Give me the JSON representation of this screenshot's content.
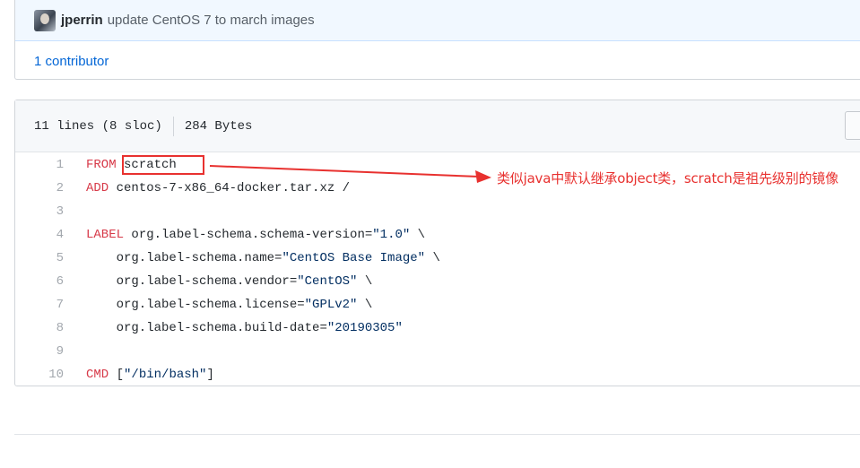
{
  "commit": {
    "author": "jperrin",
    "message": "update CentOS 7 to march images",
    "contributors": "1 contributor"
  },
  "file": {
    "lines_info": "11 lines (8 sloc)",
    "size": "284 Bytes"
  },
  "code": [
    {
      "num": "1",
      "kw": "FROM",
      "rest": " scratch"
    },
    {
      "num": "2",
      "kw": "ADD",
      "rest": " centos-7-x86_64-docker.tar.xz /"
    },
    {
      "num": "3",
      "kw": "",
      "rest": ""
    },
    {
      "num": "4",
      "kw": "LABEL",
      "rest": " org.label-schema.schema-version=",
      "str": "\"1.0\"",
      "tail": " \\"
    },
    {
      "num": "5",
      "kw": "",
      "rest": "    org.label-schema.name=",
      "str": "\"CentOS Base Image\"",
      "tail": " \\"
    },
    {
      "num": "6",
      "kw": "",
      "rest": "    org.label-schema.vendor=",
      "str": "\"CentOS\"",
      "tail": " \\"
    },
    {
      "num": "7",
      "kw": "",
      "rest": "    org.label-schema.license=",
      "str": "\"GPLv2\"",
      "tail": " \\"
    },
    {
      "num": "8",
      "kw": "",
      "rest": "    org.label-schema.build-date=",
      "str": "\"20190305\"",
      "tail": ""
    },
    {
      "num": "9",
      "kw": "",
      "rest": ""
    },
    {
      "num": "10",
      "kw": "CMD",
      "rest": " [",
      "str": "\"/bin/bash\"",
      "tail": "]"
    }
  ],
  "annotation": {
    "text": "类似java中默认继承object类，scratch是祖先级别的镜像",
    "color": "#e8312f"
  },
  "colors": {
    "keyword": "#d73a49",
    "string": "#032f62",
    "link": "#0366d6"
  }
}
